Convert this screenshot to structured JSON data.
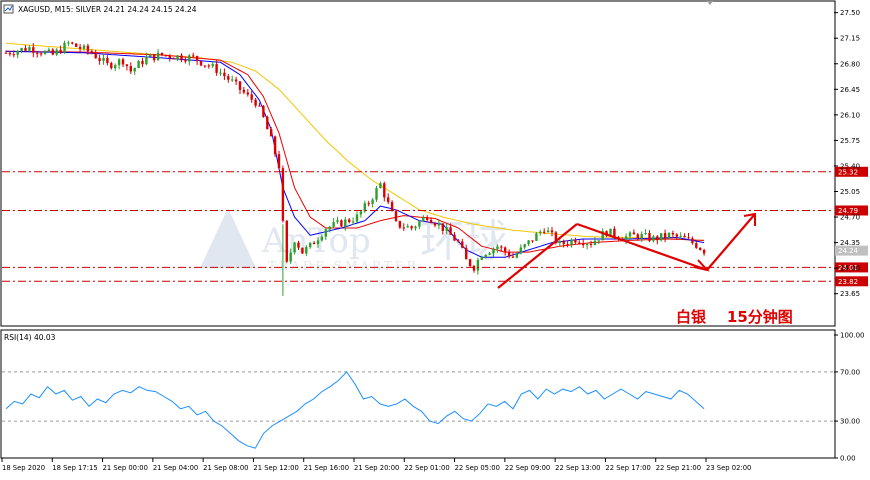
{
  "header": {
    "symbol_line": "XAGUSD, M15: SILVER  24.21 24.24 24.15 24.24",
    "rsi_label": "RSI(14) 40.03"
  },
  "watermark": {
    "brand": "AnTop",
    "cn": "环球",
    "tagline": "TRADE SMARTER"
  },
  "annotation": {
    "text": "白银    15分钟图"
  },
  "colors": {
    "bull": "#2ca02c",
    "bear": "#dd0000",
    "ma_fast": "#0000ff",
    "ma_mid": "#ee0000",
    "ma_slow": "#f2c600",
    "level": "#cc0000",
    "rsi": "#1e90ff",
    "arrow": "#e00000",
    "current_badge": "#c0c0c0"
  },
  "chart_data": [
    {
      "type": "candlestick",
      "title": "XAGUSD, M15: SILVER",
      "ylim": [
        23.55,
        27.55
      ],
      "y_ticks": [
        "27.50",
        "27.15",
        "26.80",
        "26.45",
        "26.10",
        "25.75",
        "25.40",
        "25.05",
        "24.70",
        "24.35",
        "24.00",
        "23.65"
      ],
      "x_ticks": [
        "18 Sep 2020",
        "18 Sep 17:15",
        "21 Sep 00:00",
        "21 Sep 04:00",
        "21 Sep 08:00",
        "21 Sep 12:00",
        "21 Sep 16:00",
        "21 Sep 20:00",
        "22 Sep 01:00",
        "22 Sep 05:00",
        "22 Sep 09:00",
        "22 Sep 13:00",
        "22 Sep 17:00",
        "22 Sep 21:00",
        "23 Sep 02:00"
      ],
      "close_path": [
        [
          0,
          26.95
        ],
        [
          6,
          27.02
        ],
        [
          12,
          26.92
        ],
        [
          16,
          27.08
        ],
        [
          22,
          26.95
        ],
        [
          26,
          26.78
        ],
        [
          30,
          26.85
        ],
        [
          32,
          26.7
        ],
        [
          36,
          26.88
        ],
        [
          40,
          26.92
        ],
        [
          48,
          26.88
        ],
        [
          54,
          26.72
        ],
        [
          58,
          26.55
        ],
        [
          62,
          26.35
        ],
        [
          64,
          26.28
        ],
        [
          66,
          26.05
        ],
        [
          68,
          25.75
        ],
        [
          70,
          25.4
        ],
        [
          71,
          24.6
        ],
        [
          72,
          24.05
        ],
        [
          74,
          24.4
        ],
        [
          76,
          24.22
        ],
        [
          78,
          24.3
        ],
        [
          82,
          24.55
        ],
        [
          86,
          24.62
        ],
        [
          90,
          24.7
        ],
        [
          93,
          24.9
        ],
        [
          96,
          25.15
        ],
        [
          100,
          24.6
        ],
        [
          104,
          24.55
        ],
        [
          108,
          24.72
        ],
        [
          112,
          24.55
        ],
        [
          116,
          24.35
        ],
        [
          118,
          24.1
        ],
        [
          120,
          24.02
        ],
        [
          122,
          24.2
        ],
        [
          126,
          24.3
        ],
        [
          130,
          24.15
        ],
        [
          134,
          24.35
        ],
        [
          138,
          24.55
        ],
        [
          142,
          24.32
        ],
        [
          146,
          24.4
        ],
        [
          150,
          24.35
        ],
        [
          154,
          24.5
        ],
        [
          158,
          24.42
        ],
        [
          162,
          24.45
        ],
        [
          166,
          24.4
        ],
        [
          170,
          24.45
        ],
        [
          174,
          24.4
        ],
        [
          177,
          24.32
        ],
        [
          179,
          24.24
        ]
      ],
      "n_bars": 180,
      "ma_fast_path": [
        [
          0,
          26.97
        ],
        [
          20,
          26.95
        ],
        [
          40,
          26.88
        ],
        [
          55,
          26.82
        ],
        [
          60,
          26.65
        ],
        [
          65,
          26.3
        ],
        [
          68,
          25.9
        ],
        [
          71,
          25.1
        ],
        [
          74,
          24.7
        ],
        [
          78,
          24.45
        ],
        [
          86,
          24.55
        ],
        [
          92,
          24.65
        ],
        [
          96,
          24.85
        ],
        [
          100,
          24.8
        ],
        [
          106,
          24.65
        ],
        [
          112,
          24.6
        ],
        [
          118,
          24.25
        ],
        [
          122,
          24.15
        ],
        [
          128,
          24.15
        ],
        [
          134,
          24.25
        ],
        [
          140,
          24.35
        ],
        [
          148,
          24.4
        ],
        [
          160,
          24.4
        ],
        [
          172,
          24.42
        ],
        [
          179,
          24.35
        ]
      ],
      "ma_mid_path": [
        [
          0,
          26.97
        ],
        [
          20,
          26.96
        ],
        [
          40,
          26.92
        ],
        [
          55,
          26.85
        ],
        [
          62,
          26.65
        ],
        [
          66,
          26.35
        ],
        [
          70,
          25.85
        ],
        [
          74,
          25.1
        ],
        [
          78,
          24.7
        ],
        [
          82,
          24.55
        ],
        [
          90,
          24.55
        ],
        [
          96,
          24.65
        ],
        [
          102,
          24.72
        ],
        [
          110,
          24.68
        ],
        [
          116,
          24.55
        ],
        [
          122,
          24.3
        ],
        [
          128,
          24.22
        ],
        [
          134,
          24.22
        ],
        [
          142,
          24.3
        ],
        [
          150,
          24.35
        ],
        [
          160,
          24.38
        ],
        [
          170,
          24.4
        ],
        [
          179,
          24.38
        ]
      ],
      "ma_slow_path": [
        [
          0,
          27.08
        ],
        [
          20,
          27.0
        ],
        [
          40,
          26.92
        ],
        [
          50,
          26.88
        ],
        [
          58,
          26.82
        ],
        [
          64,
          26.7
        ],
        [
          70,
          26.45
        ],
        [
          76,
          26.1
        ],
        [
          82,
          25.75
        ],
        [
          88,
          25.45
        ],
        [
          94,
          25.2
        ],
        [
          100,
          25.0
        ],
        [
          106,
          24.8
        ],
        [
          112,
          24.7
        ],
        [
          120,
          24.6
        ],
        [
          130,
          24.52
        ],
        [
          140,
          24.47
        ],
        [
          150,
          24.43
        ],
        [
          160,
          24.42
        ],
        [
          170,
          24.4
        ],
        [
          179,
          24.38
        ]
      ],
      "levels": [
        {
          "value": 25.32,
          "label": "25.32"
        },
        {
          "value": 24.79,
          "label": "24.79"
        },
        {
          "value": 24.01,
          "label": "24.01"
        },
        {
          "value": 23.82,
          "label": "23.82"
        }
      ],
      "current_price": {
        "value": 24.24,
        "label": "24.24"
      }
    },
    {
      "type": "line",
      "title": "RSI(14)",
      "ylim": [
        0,
        100
      ],
      "y_ticks": [
        "100.00",
        "70.00",
        "30.00",
        "0.00"
      ],
      "dashed_levels": [
        70,
        30
      ],
      "values": [
        40,
        46,
        44,
        52,
        49,
        58,
        52,
        55,
        47,
        50,
        42,
        48,
        45,
        52,
        55,
        53,
        58,
        55,
        54,
        50,
        46,
        40,
        42,
        35,
        38,
        30,
        26,
        20,
        14,
        10,
        8,
        20,
        26,
        30,
        34,
        38,
        44,
        48,
        54,
        58,
        63,
        70,
        60,
        48,
        50,
        44,
        42,
        44,
        48,
        42,
        38,
        30,
        28,
        34,
        38,
        32,
        30,
        36,
        44,
        42,
        46,
        40,
        52,
        55,
        48,
        56,
        52,
        56,
        54,
        58,
        52,
        55,
        48,
        52,
        56,
        52,
        48,
        54,
        52,
        50,
        48,
        55,
        52,
        46,
        40
      ]
    }
  ]
}
